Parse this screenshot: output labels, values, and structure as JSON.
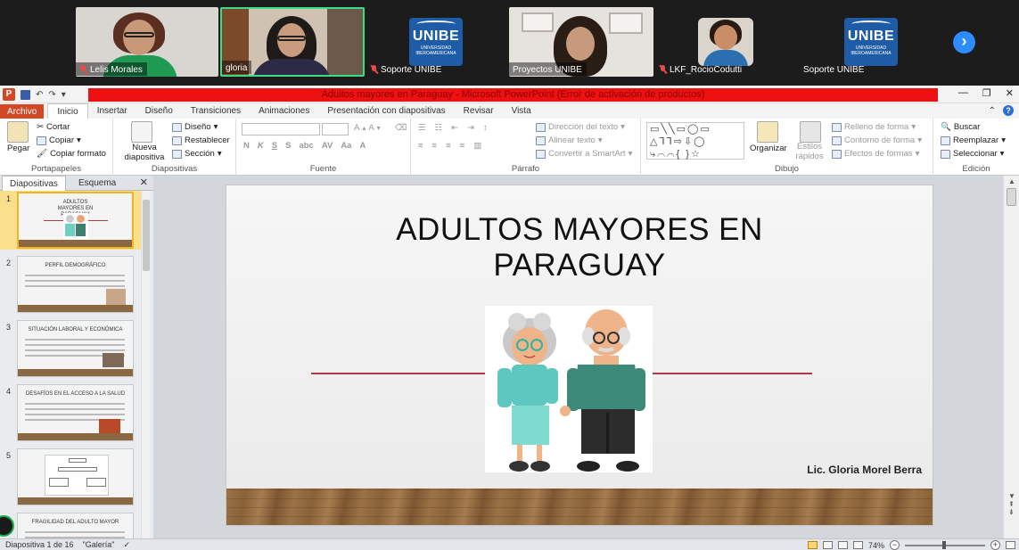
{
  "meeting": {
    "participants": [
      {
        "name": "Lelis Morales",
        "muted": true
      },
      {
        "name": "gloria",
        "muted": false,
        "active_speaker": true
      },
      {
        "name": "Soporte UNIBE",
        "muted": true
      },
      {
        "name": "Proyectos UNIBE",
        "muted": false
      },
      {
        "name": "LKF_RocioCodutti",
        "muted": true
      },
      {
        "name": "Soporte UNIBE",
        "muted": false
      }
    ],
    "logo": {
      "name": "UNIBE",
      "subtitle": "UNIVERSIDAD IBEROAMERICANA"
    },
    "next_icon": "chevron-right-icon"
  },
  "ppt": {
    "title": "Adultos mayores en Paraguay  -  Microsoft PowerPoint (Error de activación de productos)",
    "tabs": [
      "Archivo",
      "Inicio",
      "Insertar",
      "Diseño",
      "Transiciones",
      "Animaciones",
      "Presentación con diapositivas",
      "Revisar",
      "Vista"
    ],
    "ribbon": {
      "portapapeles": {
        "label": "Portapapeles",
        "paste": "Pegar",
        "cut": "Cortar",
        "copy": "Copiar",
        "format_painter": "Copiar formato"
      },
      "diapositivas": {
        "label": "Diapositivas",
        "new_slide": "Nueva diapositiva",
        "layout": "Diseño",
        "reset": "Restablecer",
        "section": "Sección"
      },
      "fuente": {
        "label": "Fuente"
      },
      "parrafo": {
        "label": "Párrafo",
        "text_direction": "Dirección del texto",
        "align_text": "Alinear texto",
        "smartart": "Convertir a SmartArt"
      },
      "dibujo": {
        "label": "Dibujo",
        "arrange": "Organizar",
        "quick_styles": "Estilos rápidos",
        "fill": "Relleno de forma",
        "outline": "Contorno de forma",
        "effects": "Efectos de formas"
      },
      "edicion": {
        "label": "Edición",
        "find": "Buscar",
        "replace": "Reemplazar",
        "select": "Seleccionar"
      }
    },
    "pane": {
      "tab_slides": "Diapositivas",
      "tab_outline": "Esquema",
      "close": "✕"
    },
    "thumbnails": [
      {
        "num": "1",
        "title": "ADULTOS MAYORES EN PARAGUAY"
      },
      {
        "num": "2",
        "title": "PERFIL DEMOGRÁFICO"
      },
      {
        "num": "3",
        "title": "SITUACIÓN LABORAL Y ECONÓMICA"
      },
      {
        "num": "4",
        "title": "DESAFÍOS EN EL ACCESO A LA SALUD"
      },
      {
        "num": "5",
        "title": ""
      },
      {
        "num": "6",
        "title": "FRAGILIDAD DEL ADULTO MAYOR"
      }
    ],
    "slide": {
      "title_line1": "ADULTOS MAYORES EN",
      "title_line2": "PARAGUAY",
      "author": "Lic. Gloria Morel Berra"
    },
    "status": {
      "slide_info": "Diapositiva 1 de 16",
      "theme": "\"Galería\"",
      "zoom": "74%"
    }
  }
}
